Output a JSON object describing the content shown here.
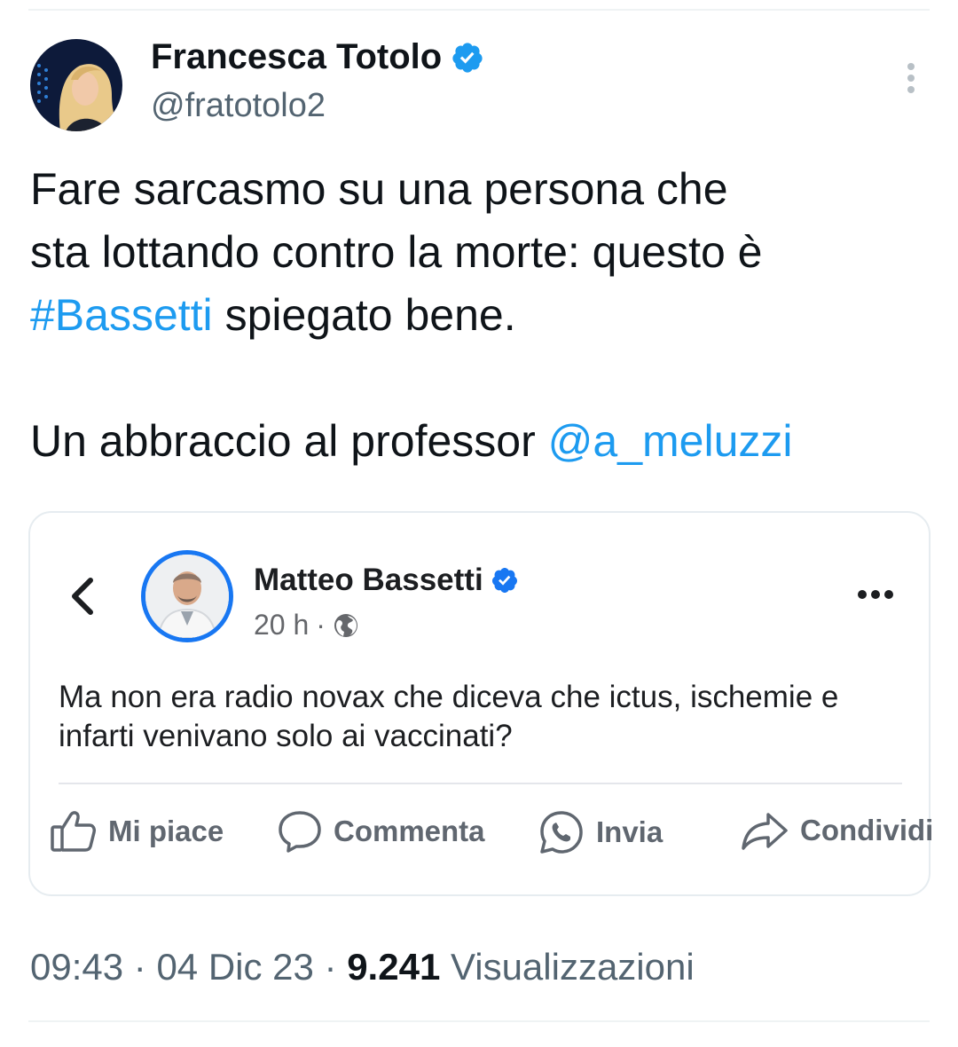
{
  "tweet": {
    "author": {
      "name": "Francesca Totolo",
      "handle": "@fratotolo2",
      "verified": true,
      "avatar_icon": "profile-photo"
    },
    "text": {
      "line1": "Fare sarcasmo su una persona che",
      "line2": "sta lottando contro la morte: questo è",
      "hashtag": "#Bassetti",
      "line3_rest": " spiegato bene.",
      "line4_prefix": "Un abbraccio al professor ",
      "mention": "@a_meluzzi"
    },
    "meta": {
      "time": "09:43",
      "separator": " · ",
      "date": "04 Dic 23",
      "views_count": "9.241",
      "views_label": "Visualizzazioni"
    },
    "colors": {
      "link": "#1d9bf0",
      "verified": "#1d9bf0",
      "muted": "#536471"
    }
  },
  "embedded_post": {
    "author": {
      "name": "Matteo Bassetti",
      "verified": true
    },
    "time": "20 h",
    "separator": "·",
    "privacy_icon": "globe-icon",
    "text": "Ma non era radio novax che diceva che ictus, ischemie e infarti venivano solo ai vaccinati?",
    "actions": [
      {
        "label": "Mi piace",
        "icon": "thumbs-up-icon"
      },
      {
        "label": "Commenta",
        "icon": "comment-bubble-icon"
      },
      {
        "label": "Invia",
        "icon": "whatsapp-icon"
      },
      {
        "label": "Condividi",
        "icon": "share-arrow-icon"
      }
    ],
    "colors": {
      "accent": "#1877f2",
      "text": "#1c1e21",
      "muted": "#65676b"
    }
  }
}
